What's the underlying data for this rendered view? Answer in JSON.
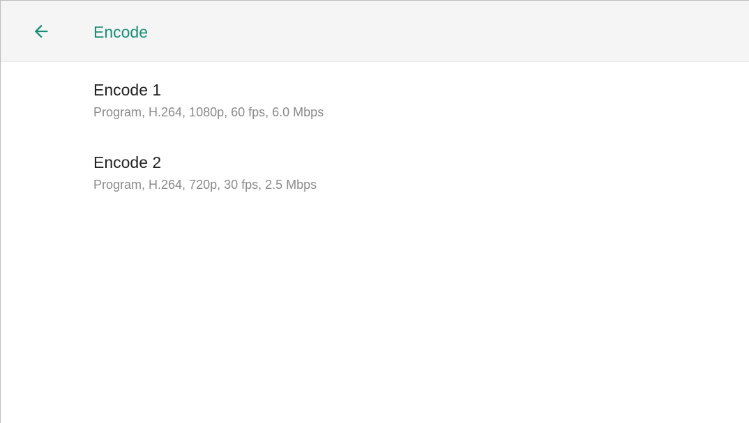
{
  "header": {
    "title": "Encode",
    "back_icon": "arrow-back-icon"
  },
  "colors": {
    "accent": "#178f77",
    "appbar_bg": "#f5f5f5",
    "primary_text": "#212121",
    "secondary_text": "#8a8a8a"
  },
  "encodes": [
    {
      "title": "Encode 1",
      "summary": "Program, H.264, 1080p, 60 fps, 6.0 Mbps"
    },
    {
      "title": "Encode 2",
      "summary": "Program, H.264, 720p, 30 fps, 2.5 Mbps"
    }
  ]
}
